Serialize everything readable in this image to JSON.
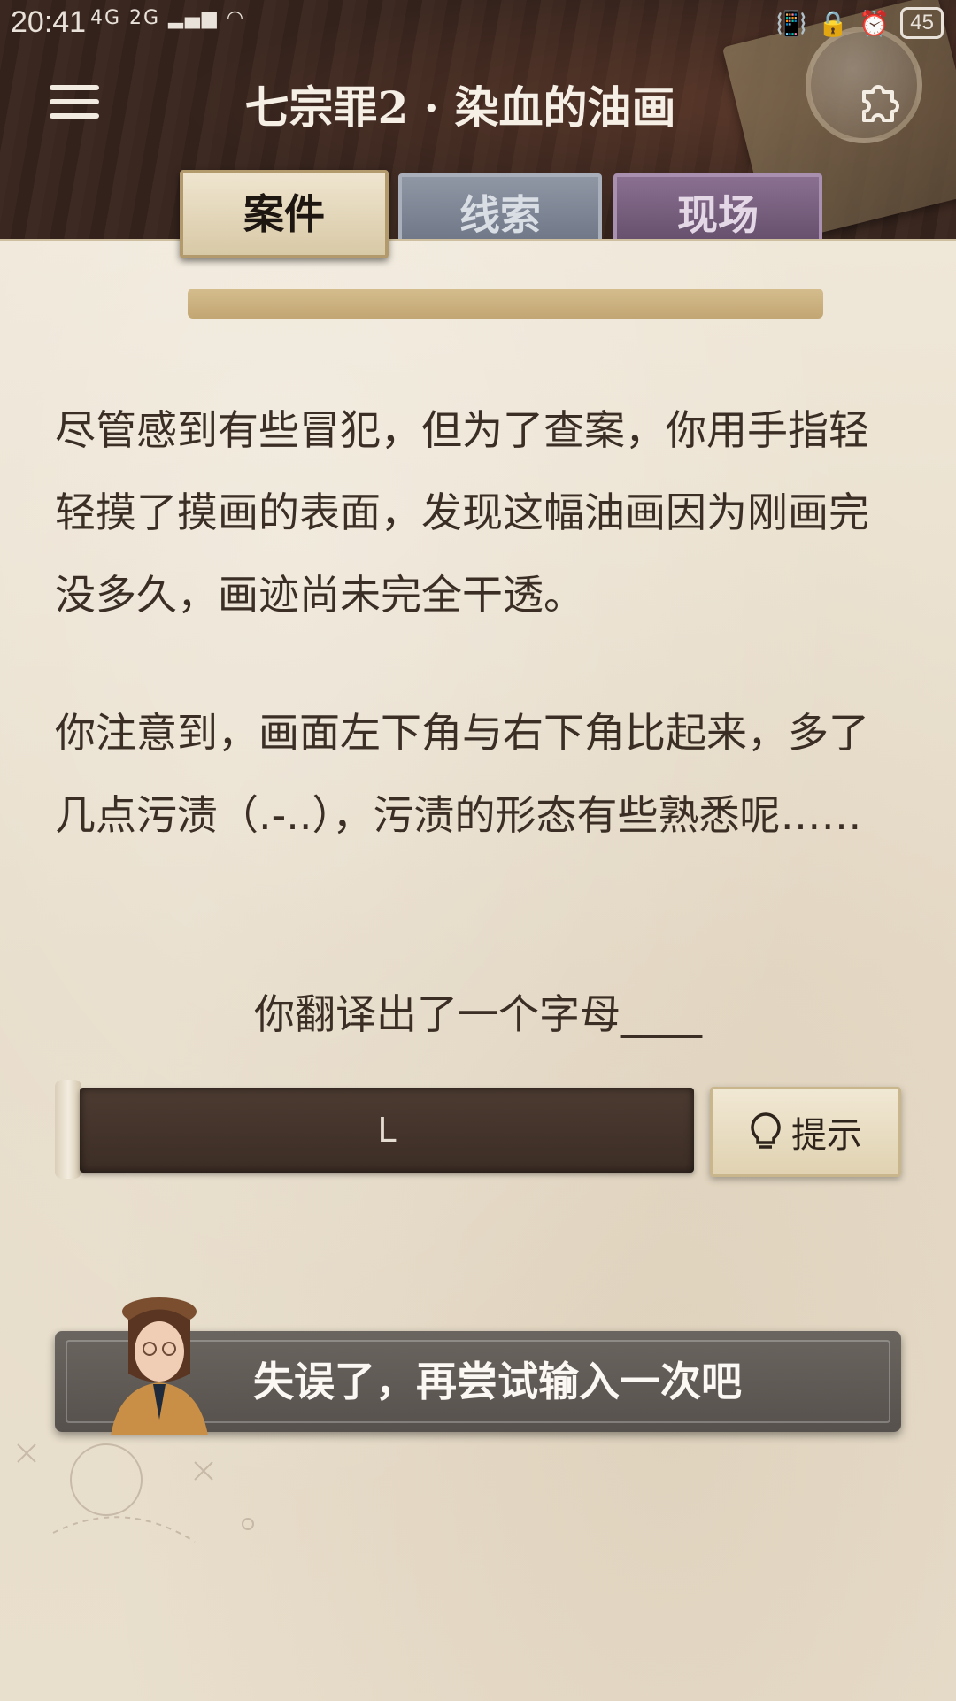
{
  "status_bar": {
    "time": "20:41",
    "network_left": "4G 2G",
    "battery": "45",
    "icons": [
      "signal-icon",
      "wifi-icon",
      "vibrate-icon",
      "lock-icon",
      "alarm-icon",
      "battery-icon"
    ]
  },
  "header": {
    "title": "七宗罪2 · 染血的油画",
    "menu_icon": "menu-icon",
    "settings_icon": "puzzle-icon"
  },
  "tabs": [
    {
      "label": "案件",
      "active": true
    },
    {
      "label": "线索",
      "active": false
    },
    {
      "label": "现场",
      "active": false
    }
  ],
  "story": {
    "paragraph1": "尽管感到有些冒犯，但为了查案，你用手指轻轻摸了摸画的表面，发现这幅油画因为刚画完没多久，画迹尚未完全干透。",
    "paragraph2": "你注意到，画面左下角与右下角比起来，多了几点污渍（.-..），污渍的形态有些熟悉呢……"
  },
  "question": {
    "prompt": "你翻译出了一个字母____",
    "answer_value": "L"
  },
  "hint_button": {
    "label": "提示",
    "icon": "lightbulb-icon"
  },
  "toast": {
    "message": "失误了，再尝试输入一次吧"
  },
  "colors": {
    "paper": "#ece3d2",
    "text": "#3b2f25",
    "answer_box": "#43342b",
    "toast": "#5f5955"
  }
}
